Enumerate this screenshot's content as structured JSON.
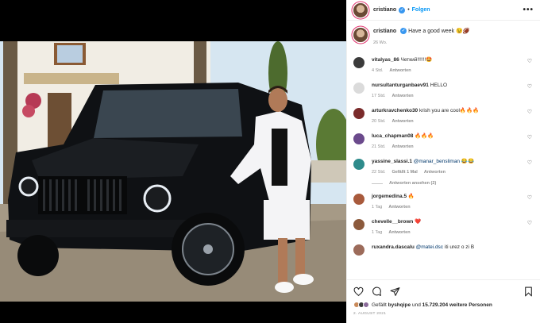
{
  "header": {
    "username": "cristiano",
    "separator": "•",
    "follow_label": "Folgen",
    "more_label": "•••"
  },
  "caption": {
    "username": "cristiano",
    "text": "Have a good week 😉🏈",
    "time": "26 Wo."
  },
  "comments": [
    {
      "user": "vitalyas_86",
      "text": "Четкий!!!!!!🤩",
      "time": "4 Std.",
      "likes": "",
      "reply": "Antworten",
      "avatar_color": "#3b3b3b"
    },
    {
      "user": "nursultanturganbaev91",
      "text": "HELLO",
      "time": "17 Std.",
      "likes": "",
      "reply": "Antworten",
      "avatar_color": "#dbdbdb"
    },
    {
      "user": "arturkravchenko30",
      "text": "krish you are cool🔥🔥🔥",
      "time": "20 Std.",
      "likes": "",
      "reply": "Antworten",
      "avatar_color": "#7a2b2b"
    },
    {
      "user": "luca_chapman08",
      "text": "🔥🔥🔥",
      "time": "21 Std.",
      "likes": "",
      "reply": "Antworten",
      "avatar_color": "#6b4a8c"
    },
    {
      "user": "yassine_slassi.1",
      "mention": "@manar_bensliman",
      "text": "😂😂",
      "time": "22 Std.",
      "likes": "Gefällt 1 Mal",
      "reply": "Antworten",
      "avatar_color": "#2e8b8b",
      "view_replies": "Antworten ansehen (2)"
    },
    {
      "user": "jorgemedina.5",
      "text": "🔥",
      "time": "1 Tag",
      "likes": "",
      "reply": "Antworten",
      "avatar_color": "#a85a3c"
    },
    {
      "user": "chevelle__brown",
      "text": "❤️",
      "time": "1 Tag",
      "likes": "",
      "reply": "Antworten",
      "avatar_color": "#8c5a3c"
    },
    {
      "user": "ruxandra.dascalu",
      "mention": "@matei.dsc",
      "text": "iti urez o zi B",
      "time": "",
      "likes": "",
      "reply": "",
      "avatar_color": "#9c6b5a"
    }
  ],
  "actions": {
    "like_icon": "heart-icon",
    "comment_icon": "comment-icon",
    "share_icon": "share-icon",
    "save_icon": "bookmark-icon"
  },
  "likes": {
    "prefix": "Gefällt",
    "first_user": "byshqipe",
    "middle": "und",
    "count": "15.729.204",
    "suffix": "weitere Personen"
  },
  "date": "2. AUGUST 2021",
  "colors": {
    "accent": "#0095f6",
    "verified": "#3897f0",
    "muted": "#8e8e8e",
    "heart_red": "#ed4956"
  }
}
